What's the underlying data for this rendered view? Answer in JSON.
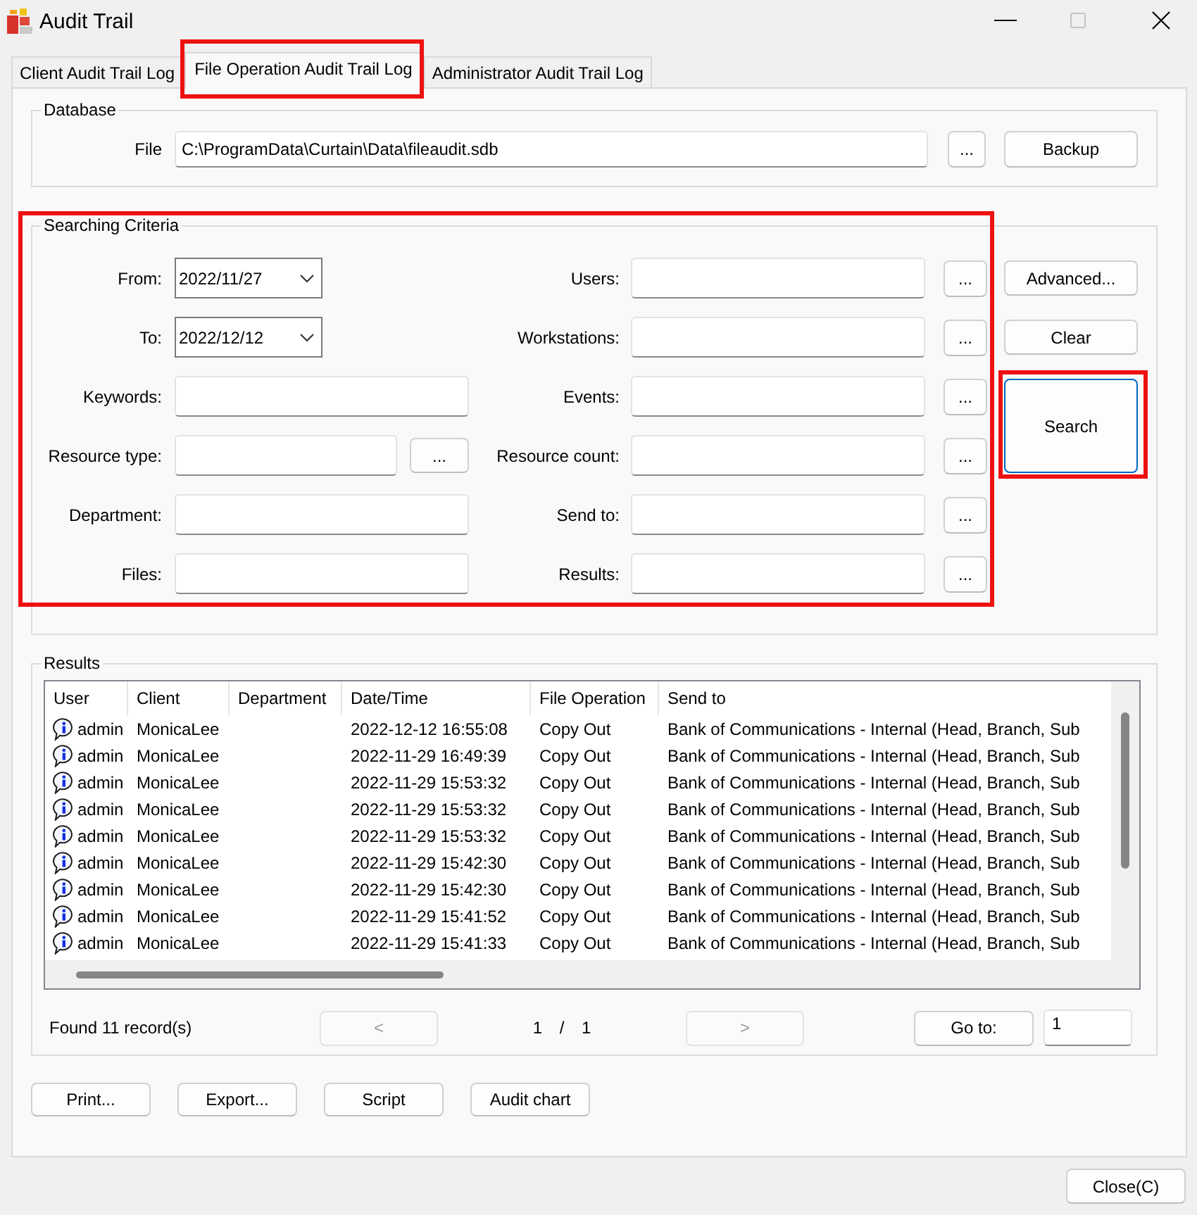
{
  "window": {
    "title": "Audit Trail",
    "maximize_enabled": false
  },
  "tabs": [
    {
      "label": "Client Audit Trail Log",
      "selected": false,
      "highlighted": false
    },
    {
      "label": "File Operation Audit Trail Log",
      "selected": true,
      "highlighted": true
    },
    {
      "label": "Administrator Audit Trail Log",
      "selected": false,
      "highlighted": false
    }
  ],
  "database": {
    "title": "Database",
    "file": {
      "label": "File",
      "value": "C:\\ProgramData\\Curtain\\Data\\fileaudit.sdb"
    },
    "browse": "...",
    "backup": "Backup"
  },
  "criteria": {
    "title": "Searching Criteria",
    "highlighted": true,
    "rows": [
      {
        "left": {
          "label": "From:",
          "kind": "date",
          "value": "2022/11/27"
        },
        "right": {
          "label": "Users:",
          "kind": "text",
          "browse": "..."
        }
      },
      {
        "left": {
          "label": "To:",
          "kind": "date",
          "value": "2022/12/12"
        },
        "right": {
          "label": "Workstations:",
          "kind": "text",
          "browse": "..."
        }
      },
      {
        "left": {
          "label": "Keywords:",
          "kind": "text"
        },
        "right": {
          "label": "Events:",
          "kind": "text",
          "browse": "..."
        }
      },
      {
        "left": {
          "label": "Resource type:",
          "kind": "text",
          "browse": "..."
        },
        "right": {
          "label": "Resource count:",
          "kind": "text",
          "browse": "..."
        }
      },
      {
        "left": {
          "label": "Department:",
          "kind": "text"
        },
        "right": {
          "label": "Send to:",
          "kind": "text",
          "browse": "..."
        }
      },
      {
        "left": {
          "label": "Files:",
          "kind": "text"
        },
        "right": {
          "label": "Results:",
          "kind": "text",
          "browse": "..."
        }
      }
    ],
    "actions": [
      {
        "label": "Advanced...",
        "focused": false,
        "highlighted": false
      },
      {
        "label": "Clear",
        "focused": false,
        "highlighted": false
      },
      {
        "label": "Search",
        "focused": true,
        "highlighted": true
      }
    ]
  },
  "results": {
    "title": "Results",
    "columns": [
      "User",
      "Client",
      "Department",
      "Date/Time",
      "File Operation",
      "Send to"
    ],
    "rows": [
      {
        "user": "admin",
        "client": "MonicaLee",
        "date_time": "2022-12-12 16:55:08",
        "file_operation": "Copy Out",
        "send_to": "Bank of Communications - Internal (Head, Branch, Sub"
      },
      {
        "user": "admin",
        "client": "MonicaLee",
        "date_time": "2022-11-29 16:49:39",
        "file_operation": "Copy Out",
        "send_to": "Bank of Communications - Internal (Head, Branch, Sub"
      },
      {
        "user": "admin",
        "client": "MonicaLee",
        "date_time": "2022-11-29 15:53:32",
        "file_operation": "Copy Out",
        "send_to": "Bank of Communications - Internal (Head, Branch, Sub"
      },
      {
        "user": "admin",
        "client": "MonicaLee",
        "date_time": "2022-11-29 15:53:32",
        "file_operation": "Copy Out",
        "send_to": "Bank of Communications - Internal (Head, Branch, Sub"
      },
      {
        "user": "admin",
        "client": "MonicaLee",
        "date_time": "2022-11-29 15:53:32",
        "file_operation": "Copy Out",
        "send_to": "Bank of Communications - Internal (Head, Branch, Sub"
      },
      {
        "user": "admin",
        "client": "MonicaLee",
        "date_time": "2022-11-29 15:42:30",
        "file_operation": "Copy Out",
        "send_to": "Bank of Communications - Internal (Head, Branch, Sub"
      },
      {
        "user": "admin",
        "client": "MonicaLee",
        "date_time": "2022-11-29 15:42:30",
        "file_operation": "Copy Out",
        "send_to": "Bank of Communications - Internal (Head, Branch, Sub"
      },
      {
        "user": "admin",
        "client": "MonicaLee",
        "date_time": "2022-11-29 15:41:52",
        "file_operation": "Copy Out",
        "send_to": "Bank of Communications - Internal (Head, Branch, Sub"
      },
      {
        "user": "admin",
        "client": "MonicaLee",
        "date_time": "2022-11-29 15:41:33",
        "file_operation": "Copy Out",
        "send_to": "Bank of Communications - Internal (Head, Branch, Sub"
      }
    ],
    "status": "Found 11 record(s)",
    "prev": {
      "label": "<",
      "disabled": true
    },
    "page": "1 / 1",
    "next": {
      "label": ">",
      "disabled": true
    },
    "goto": {
      "label": "Go to:",
      "value": "1"
    }
  },
  "buttons": [
    "Print...",
    "Export...",
    "Script",
    "Audit chart"
  ],
  "close": "Close(C)"
}
